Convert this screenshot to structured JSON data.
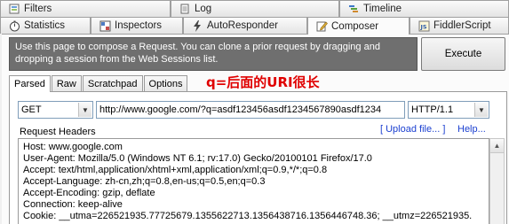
{
  "tabs_top": [
    {
      "label": "Filters",
      "icon": "filters-icon"
    },
    {
      "label": "Log",
      "icon": "log-icon"
    },
    {
      "label": "Timeline",
      "icon": "timeline-icon"
    }
  ],
  "tabs_main": [
    {
      "label": "Statistics",
      "icon": "stopwatch-icon"
    },
    {
      "label": "Inspectors",
      "icon": "inspectors-icon"
    },
    {
      "label": "AutoResponder",
      "icon": "lightning-icon"
    },
    {
      "label": "Composer",
      "icon": "pencil-icon"
    },
    {
      "label": "FiddlerScript",
      "icon": "script-icon"
    }
  ],
  "banner": {
    "text": "Use this page to compose a Request. You can clone a prior request by dragging and dropping a session from the Web Sessions list."
  },
  "execute_label": "Execute",
  "subtabs": [
    "Parsed",
    "Raw",
    "Scratchpad",
    "Options"
  ],
  "annotation": "q=后面的URI很长",
  "method": "GET",
  "url": "http://www.google.com/?q=asdf123456asdf1234567890asdf1234",
  "http_version": "HTTP/1.1",
  "request_headers_label": "Request Headers",
  "upload_link": "[ Upload file... ]",
  "help_link": "Help...",
  "headers": [
    "Host: www.google.com",
    "User-Agent: Mozilla/5.0 (Windows NT 6.1; rv:17.0) Gecko/20100101 Firefox/17.0",
    "Accept: text/html,application/xhtml+xml,application/xml;q=0.9,*/*;q=0.8",
    "Accept-Language: zh-cn,zh;q=0.8,en-us;q=0.5,en;q=0.3",
    "Accept-Encoding: gzip, deflate",
    "Connection: keep-alive",
    "Cookie: __utma=226521935.77725679.1355622713.1356438716.1356446748.36; __utmz=226521935."
  ]
}
